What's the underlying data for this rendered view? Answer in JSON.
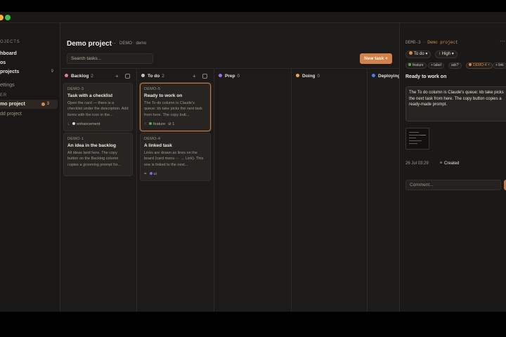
{
  "sidebar": {
    "projects_heading": "OJECTS",
    "nav": [
      {
        "label": "hboard"
      },
      {
        "label": "os"
      },
      {
        "label": "projects",
        "count": "9"
      }
    ],
    "settings_label": "ettings",
    "pinned_heading": "ER",
    "active_project": {
      "label": "mo project",
      "count": "3"
    },
    "add_project_label": "dd project"
  },
  "main": {
    "title": "Demo project",
    "menu_glyph": "···",
    "crumb": "DEMO · demo",
    "search_placeholder": "Search tasks...",
    "new_task_label": "New task +"
  },
  "columns": [
    {
      "name": "Backlog",
      "count": "2",
      "color": "#e87a9a"
    },
    {
      "name": "To do",
      "count": "2",
      "color": "#c8c2b8"
    },
    {
      "name": "Prep",
      "count": "0",
      "color": "#a56ae8"
    },
    {
      "name": "Doing",
      "count": "0",
      "color": "#f0a83a"
    },
    {
      "name": "Deploying",
      "count": "",
      "color": "#4a7ef0"
    }
  ],
  "cards": {
    "backlog": [
      {
        "id": "DEMO-3",
        "title": "Task with a checklist",
        "desc": "Open the card — there is a checklist under the description. Add items with the icon in the...",
        "prio": "↓",
        "label": "enhancement",
        "label_color": "#c8d8f0"
      },
      {
        "id": "DEMO-1",
        "title": "An idea in the backlog",
        "desc": "All ideas land here. The copy button on the Backlog column copies a grooming prompt for..."
      }
    ],
    "todo": [
      {
        "id": "DEMO-5",
        "title": "Ready to work on",
        "desc": "The To do column is Claude's queue: kb take picks the next task from here. The copy butt...",
        "prio": "↑",
        "label": "feature",
        "label_color": "#4caf50",
        "link": "1"
      },
      {
        "id": "DEMO-4",
        "title": "A linked task",
        "desc": "Links are drawn as lines on the board (card menu ··· → Link). This one is linked to the next...",
        "prio": "=",
        "label": "ui",
        "label_color": "#7c6ae8"
      }
    ]
  },
  "panel": {
    "id": "DEMO-3",
    "separator": "·",
    "project": "Demo project",
    "more": "···",
    "status": "To do",
    "status_color": "#d98b4b",
    "priority": "High",
    "tags": [
      "feature",
      "+ label",
      "ask?",
      "DEMO-4",
      "+ link"
    ],
    "title": "Ready to work on",
    "description": "The To do column is Claude's queue: kb take picks the next task from here. The copy button copies a ready-made prompt.",
    "date": "26 Jul 03:29",
    "event": "Created",
    "comment_placeholder": "Comment..."
  }
}
